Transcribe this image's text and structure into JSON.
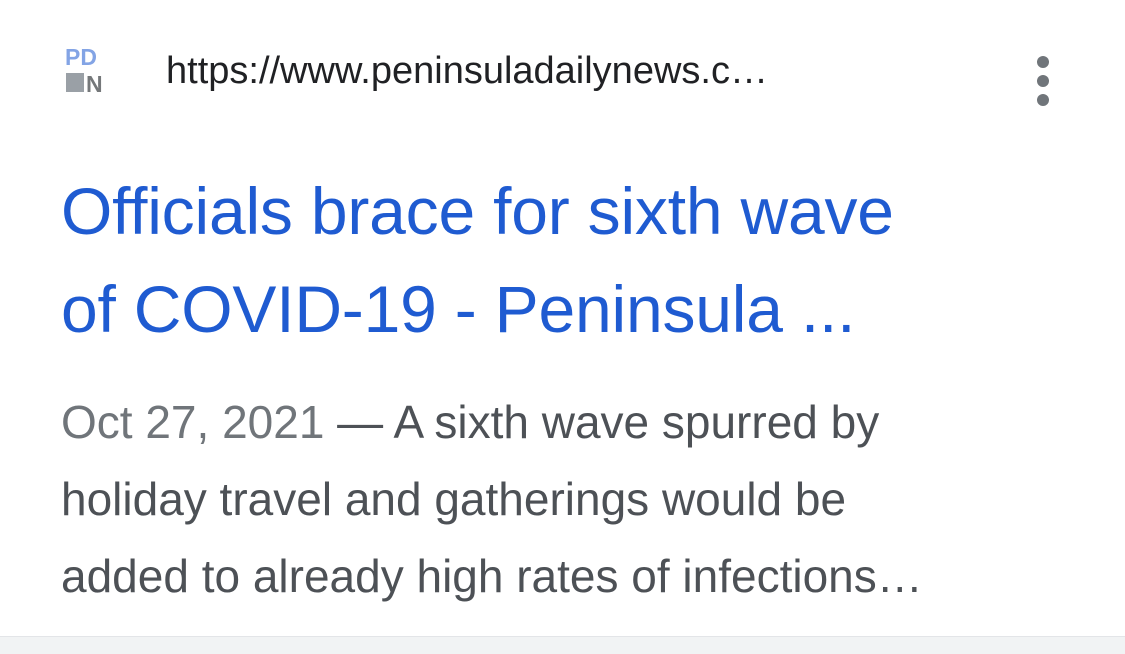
{
  "result": {
    "favicon_label": "PDN",
    "favicon_icon": "peninsula-daily-news-logo-icon",
    "url": "https://www.peninsuladailynews.c…",
    "more_icon": "more-vertical-icon",
    "title_line1": "Officials brace for sixth wave",
    "title_line2": "of COVID-19 - Peninsula ...",
    "date": "Oct 27, 2021",
    "separator": " — ",
    "snippet_line1": "A sixth wave spurred by",
    "snippet_line2": "holiday travel and gatherings would be",
    "snippet_line3": "added to already high rates of infections…"
  },
  "colors": {
    "title": "#1f5bd1",
    "url": "#202124",
    "snippet": "#4d5156",
    "date": "#70757a"
  }
}
